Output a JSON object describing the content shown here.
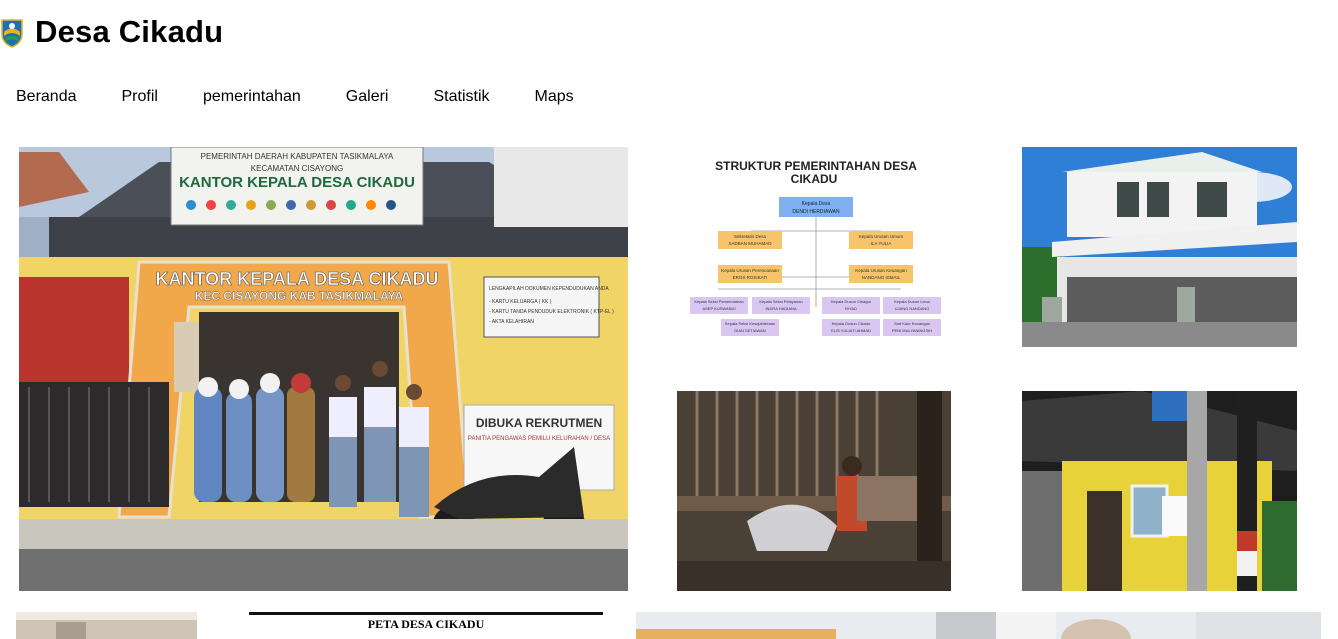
{
  "site": {
    "title": "Desa Cikadu",
    "logo_icon": "village-emblem-icon"
  },
  "nav": {
    "items": [
      {
        "label": "Beranda"
      },
      {
        "label": "Profil"
      },
      {
        "label": "pemerintahan"
      },
      {
        "label": "Galeri"
      },
      {
        "label": "Statistik"
      },
      {
        "label": "Maps"
      }
    ]
  },
  "gallery": {
    "office_photo": {
      "sign_line1": "PEMERINTAH DAERAH KABUPATEN TASIKMALAYA",
      "sign_line2": "KECAMATAN CISAYONG",
      "sign_main": "KANTOR KEPALA DESA CIKADU",
      "facade_main": "KANTOR KEPALA DESA CIKADU",
      "facade_sub": "KEC CISAYONG KAB TASIKMALAYA",
      "banner_title": "DIBUKA REKRUTMEN",
      "banner_sub": "PANITIA PENGAWAS PEMILU KELURAHAN / DESA",
      "board_title": "LENGKAPILAH DOKUMEN KEPENDUDUKAN ANDA",
      "board_items": [
        "- KARTU KELUARGA ( KK )",
        "- KARTU TANDA PENDUDUK ELEKTRONIK ( KTP-EL )",
        "- AKTA KELAHIRAN"
      ]
    },
    "org_chart": {
      "title_line1": "STRUKTUR  PEMERINTAHAN DESA",
      "title_line2": "CIKADU",
      "head_role": "Kepala Desa",
      "head_name": "DENDI HERDIAWAN",
      "sekdes_role": "Sekretaris Desa",
      "sekdes_name": "SADBAN MUHAMAD",
      "umum_role": "Kepala Urusan Umum",
      "umum_name": "ILA YULIA",
      "perencanaan_role": "Kepala Urusan Perencanaan",
      "perencanaan_name": "EROS ROSIKATI",
      "keuangan_role": "Kepala Urusan Keuangan",
      "keuangan_name": "NANDANG ISMAIL",
      "pemerintahan_role": "Kepala Seksi Pemerintahan",
      "pemerintahan_name": "ASEP KUSWANDI",
      "pelayanan_role": "Kepala Seksi Pelayanan",
      "pelayanan_name": "INDRA HADIANA",
      "kesejahteraan_role": "Kepala Seksi Kesejahteraan",
      "kesejahteraan_name": "DIAN SETIAWAN",
      "dusun1_role": "Kepala Dusun Cibagor",
      "dusun1_name": "RIYAD",
      "dusun2_role": "Kepala Dusun Cikadu",
      "dusun2_name": "ELIS YULIATI AHMAD",
      "dusun3_role": "Kepala Dusun Lieus",
      "dusun3_name": "UJANG NANDANG",
      "staf_role": "Staf Kaur Keuangan",
      "staf_name": "PENI MULYANINGSIH"
    },
    "map_title": "PETA DESA CIKADU"
  }
}
